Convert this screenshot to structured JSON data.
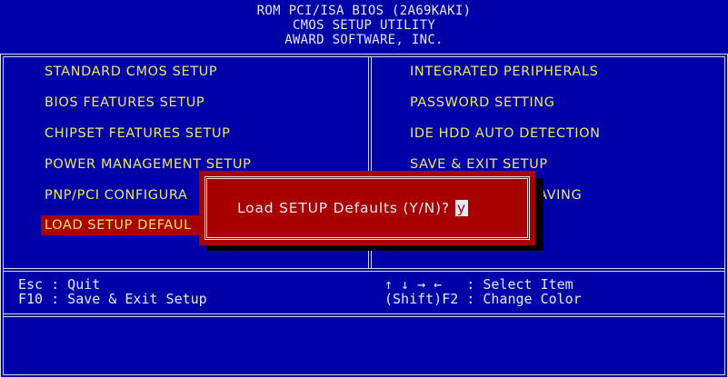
{
  "header": {
    "line1": "ROM PCI/ISA BIOS (2A69KAKI)",
    "line2": "CMOS SETUP UTILITY",
    "line3": "AWARD SOFTWARE, INC."
  },
  "menu": {
    "left": [
      "STANDARD CMOS SETUP",
      "BIOS FEATURES SETUP",
      "CHIPSET FEATURES SETUP",
      "POWER MANAGEMENT SETUP",
      "PNP/PCI CONFIGURA",
      "LOAD SETUP DEFAUL"
    ],
    "right": [
      "INTEGRATED PERIPHERALS",
      "PASSWORD SETTING",
      "IDE HDD AUTO DETECTION",
      "SAVE & EXIT SETUP",
      "SAVING"
    ],
    "selected_index": 5
  },
  "help": {
    "esc": "Esc : Quit",
    "f10": "F10 : Save & Exit Setup",
    "arrows": "↑ ↓ → ←   : Select Item",
    "shift": "(Shift)F2 : Change Color"
  },
  "dialog": {
    "prompt": "Load SETUP Defaults (Y/N)?",
    "answer": "y"
  },
  "colors": {
    "background": "#0000a8",
    "menu_text": "#f0e860",
    "highlight": "#a80000",
    "text": "#e8e8f0"
  }
}
